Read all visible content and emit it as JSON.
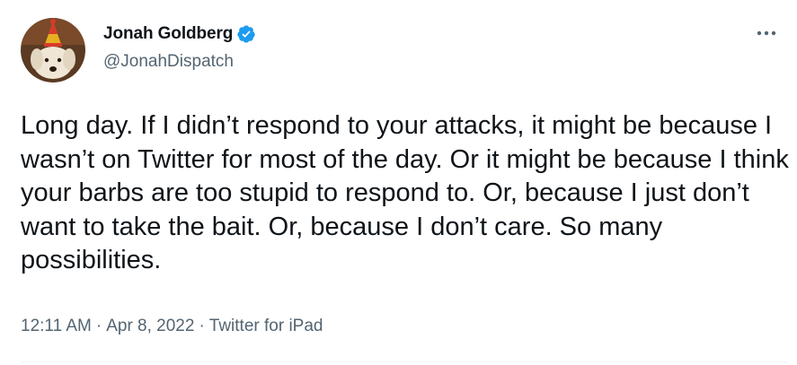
{
  "author": {
    "display_name": "Jonah Goldberg",
    "handle": "@JonahDispatch",
    "verified_icon": "verified-badge-icon",
    "avatar_icon": "dog-with-party-hat-avatar"
  },
  "tweet": {
    "text": "Long day. If I didn’t respond to your attacks, it might be because I wasn’t on Twitter for most of the day. Or it might be because I think your barbs are too stupid to respond to. Or, because I just don’t want to take the bait. Or, because I don’t care. So many possibilities.",
    "time": "12:11 AM",
    "date": "Apr 8, 2022",
    "separator": "·",
    "source": "Twitter for iPad"
  },
  "colors": {
    "accent": "#1d9bf0",
    "text_primary": "#0f1419",
    "text_secondary": "#536471",
    "divider": "#eff3f4"
  },
  "icons": {
    "more": "more-options-icon"
  }
}
